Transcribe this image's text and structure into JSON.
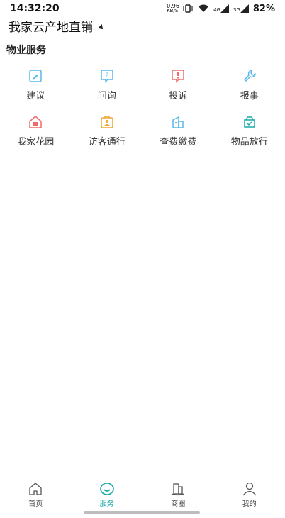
{
  "statusbar": {
    "time": "14:32:20",
    "net_speed_value": "0.96",
    "net_speed_unit": "KB/S",
    "sig1_label": "4G",
    "sig2_label": "3G",
    "battery": "82%"
  },
  "header": {
    "title": "我家云产地直销"
  },
  "service_section": {
    "title": "物业服务",
    "items": [
      {
        "label": "建议",
        "icon": "pencil-icon",
        "color": "#57b7ea"
      },
      {
        "label": "问询",
        "icon": "question-icon",
        "color": "#57b7ea"
      },
      {
        "label": "投诉",
        "icon": "complaint-icon",
        "color": "#ef6b6b"
      },
      {
        "label": "报事",
        "icon": "wrench-icon",
        "color": "#57b7ea"
      },
      {
        "label": "我家花园",
        "icon": "house-icon",
        "color": "#ef6b6b"
      },
      {
        "label": "访客通行",
        "icon": "visitor-icon",
        "color": "#f0a534"
      },
      {
        "label": "查费缴费",
        "icon": "bill-icon",
        "color": "#57b7ea"
      },
      {
        "label": "物品放行",
        "icon": "box-icon",
        "color": "#1ba9a9"
      }
    ]
  },
  "tabbar": {
    "active_color": "#1ba9a9",
    "tabs": [
      {
        "label": "首页",
        "icon": "home-icon"
      },
      {
        "label": "服务",
        "icon": "smile-icon",
        "active": true
      },
      {
        "label": "商圈",
        "icon": "building-icon"
      },
      {
        "label": "我的",
        "icon": "user-icon"
      }
    ]
  }
}
